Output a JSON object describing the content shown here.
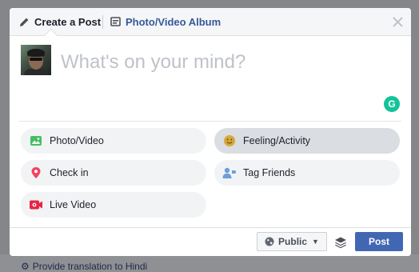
{
  "tabs": {
    "create_post": "Create a Post",
    "photo_album": "Photo/Video Album"
  },
  "composer": {
    "placeholder": "What's on your mind?"
  },
  "grammarly_icon": "grammarly-icon",
  "options": [
    {
      "label": "Photo/Video",
      "icon": "photo-icon",
      "color": "#45bd62"
    },
    {
      "label": "Feeling/Activity",
      "icon": "smiley-icon",
      "color": "#d7a83c",
      "hovered": true
    },
    {
      "label": "Check in",
      "icon": "location-pin-icon",
      "color": "#f3425f"
    },
    {
      "label": "Tag Friends",
      "icon": "tag-friends-icon",
      "color": "#6f9fd8"
    },
    {
      "label": "Live Video",
      "icon": "live-video-icon",
      "color": "#e42645"
    }
  ],
  "footer": {
    "privacy_label": "Public",
    "post_label": "Post"
  },
  "background_link": {
    "label": "Provide translation to Hindi"
  },
  "colors": {
    "accent": "#4267b2",
    "link": "#365899"
  }
}
